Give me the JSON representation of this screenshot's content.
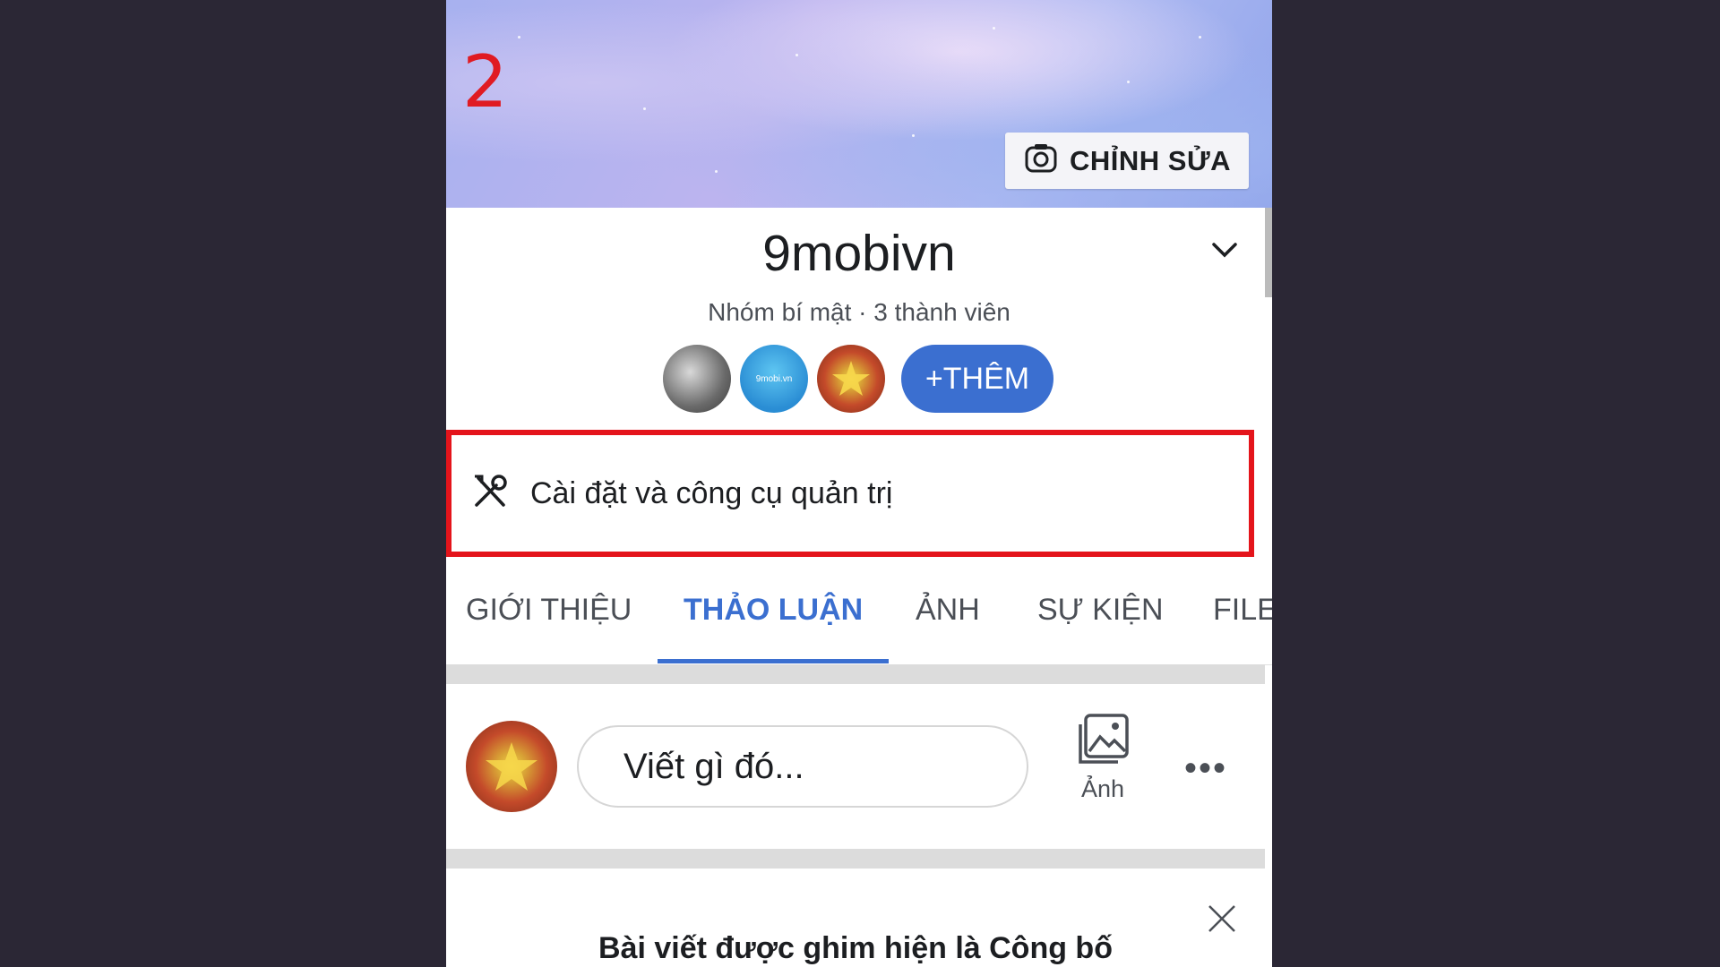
{
  "annotation": {
    "step_number": "2"
  },
  "cover": {
    "edit_label": "CHỈNH SỬA"
  },
  "group": {
    "name": "9mobivn",
    "meta": "Nhóm bí mật · 3 thành viên",
    "add_members_label": "+THÊM",
    "avatar_2_text": "9mobi.vn"
  },
  "admin_tools": {
    "label": "Cài đặt và công cụ quản trị"
  },
  "tabs": [
    {
      "label": "GIỚI THIỆU",
      "active": false
    },
    {
      "label": "THẢO LUẬN",
      "active": true
    },
    {
      "label": "ẢNH",
      "active": false
    },
    {
      "label": "SỰ KIỆN",
      "active": false
    },
    {
      "label": "FILE",
      "active": false
    }
  ],
  "composer": {
    "placeholder": "Viết gì đó...",
    "photo_label": "Ảnh",
    "more_label": "•••"
  },
  "pinned": {
    "title": "Bài viết được ghim hiện là Công bố"
  },
  "colors": {
    "accent": "#3b6fd0",
    "highlight_border": "#e4141b",
    "annotation": "#e01b22"
  },
  "icons": [
    "camera-icon",
    "chevron-down-icon",
    "admin-tools-icon",
    "photo-icon",
    "more-icon",
    "close-icon"
  ]
}
